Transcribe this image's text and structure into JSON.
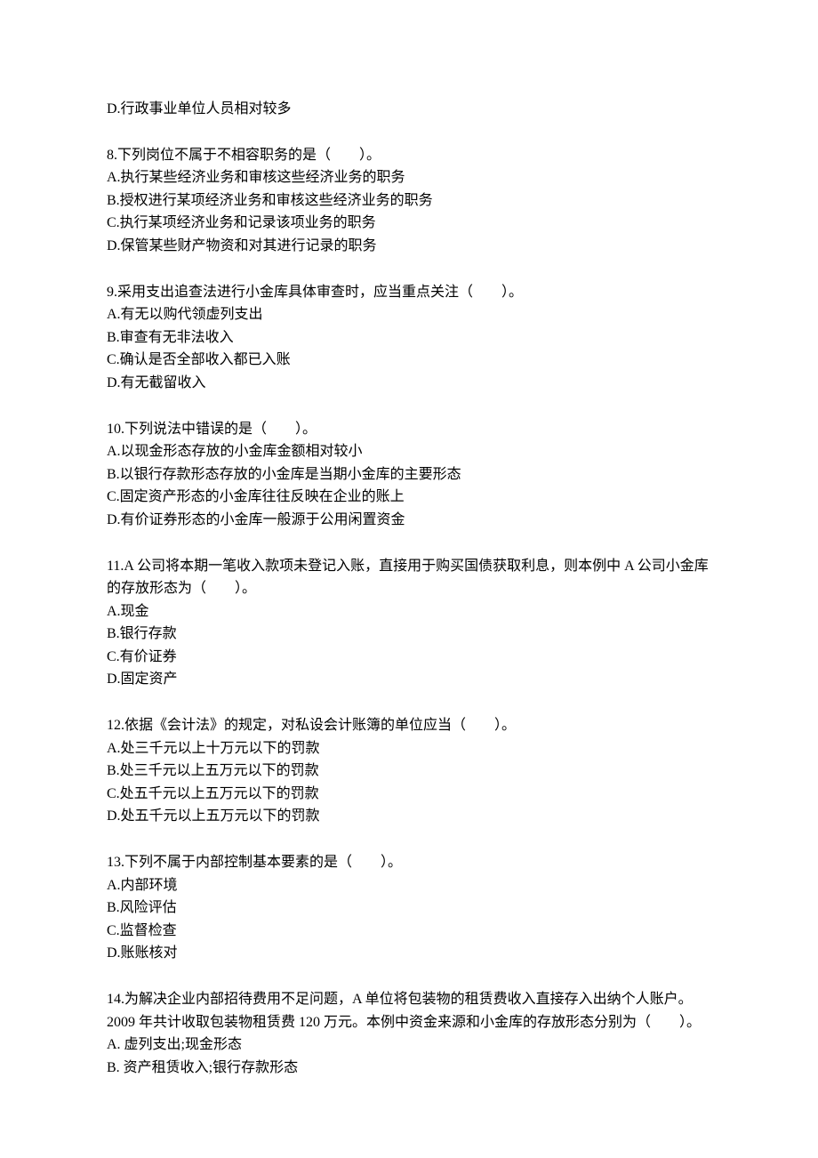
{
  "orphan_option": "D.行政事业单位人员相对较多",
  "questions": [
    {
      "stem": "8.下列岗位不属于不相容职务的是（　　）。",
      "options": [
        "A.执行某些经济业务和审核这些经济业务的职务",
        "B.授权进行某项经济业务和审核这些经济业务的职务",
        "C.执行某项经济业务和记录该项业务的职务",
        "D.保管某些财产物资和对其进行记录的职务"
      ]
    },
    {
      "stem": "9.采用支出追查法进行小金库具体审查时，应当重点关注（　　）。",
      "options": [
        "A.有无以购代领虚列支出",
        "B.审查有无非法收入",
        "C.确认是否全部收入都已入账",
        "D.有无截留收入"
      ]
    },
    {
      "stem": "10.下列说法中错误的是（　　）。",
      "options": [
        "A.以现金形态存放的小金库金额相对较小",
        "B.以银行存款形态存放的小金库是当期小金库的主要形态",
        "C.固定资产形态的小金库往往反映在企业的账上",
        "D.有价证券形态的小金库一般源于公用闲置资金"
      ]
    },
    {
      "stem": "11.A 公司将本期一笔收入款项未登记入账，直接用于购买国债获取利息，则本例中 A 公司小金库的存放形态为（　　）。",
      "options": [
        "A.现金",
        "B.银行存款",
        "C.有价证券",
        "D.固定资产"
      ]
    },
    {
      "stem": "12.依据《会计法》的规定，对私设会计账簿的单位应当（　　）。",
      "options": [
        "A.处三千元以上十万元以下的罚款",
        "B.处三千元以上五万元以下的罚款",
        "C.处五千元以上五万元以下的罚款",
        "D.处五千元以上五万元以下的罚款"
      ]
    },
    {
      "stem": "13.下列不属于内部控制基本要素的是（　　）。",
      "options": [
        "A.内部环境",
        "B.风险评估",
        "C.监督检查",
        "D.账账核对"
      ]
    },
    {
      "stem": "14.为解决企业内部招待费用不足问题，A 单位将包装物的租赁费收入直接存入出纳个人账户。2009 年共计收取包装物租赁费 120 万元。本例中资金来源和小金库的存放形态分别为（　　）。",
      "options": [
        "A. 虚列支出;现金形态",
        "B. 资产租赁收入;银行存款形态"
      ]
    }
  ]
}
